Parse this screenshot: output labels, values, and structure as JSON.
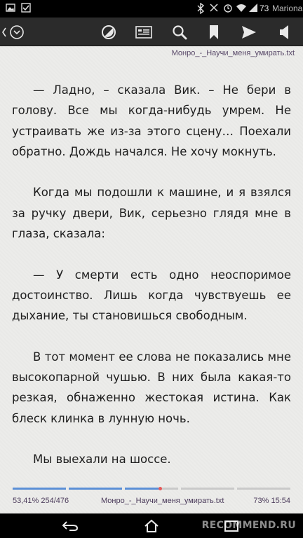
{
  "status_bar": {
    "icons": [
      "image-icon",
      "checkbox-icon",
      "bluetooth-icon",
      "signal-icon",
      "alarm-icon",
      "wifi-icon",
      "cellular-icon",
      "battery-icon"
    ],
    "battery_percent": "73",
    "carrier": "Mariona"
  },
  "toolbar": {
    "buttons": [
      "back-icon",
      "menu-circle-icon",
      "contrast-icon",
      "book-info-icon",
      "search-icon",
      "bookmark-icon",
      "send-icon",
      "volume-icon"
    ]
  },
  "reader": {
    "filename": "Монро_-_Научи_меня_умирать.txt",
    "paragraphs": [
      "— Ладно, – сказала Вик. – Не бери в голову. Все мы когда-нибудь умрем. Не устраивать же из-за этого сцену… Поехали обратно. Дождь начался. Не хочу мокнуть.",
      "Когда мы подошли к машине, и я взялся за ручку двери, Вик, серьезно глядя мне в глаза, сказала:",
      "— У смерти есть одно неоспоримое достоинство. Лишь когда чувствуешь ее дыхание, ты становишься свободным.",
      "В тот момент ее слова не показались мне высокопарной чушью. В них была какая-то резкая, обнаженно жестокая истина. Как блеск клинка в лунную ночь.",
      "Мы выехали на шоссе."
    ]
  },
  "footer": {
    "progress_text": "53,41% 254/476",
    "progress_fraction": 0.5341,
    "filename": "Монро_-_Научи_меня_умирать.txt",
    "battery_time": "73% 15:54"
  },
  "navbar": {
    "buttons": [
      "back-nav-icon",
      "home-nav-icon",
      "recent-apps-icon"
    ],
    "watermark": "RECOMMEND.RU"
  },
  "colors": {
    "toolbar_bg": "#2b2b2b",
    "page_bg": "#ececea",
    "text": "#1e1e1e",
    "progress_fill": "#5b8fd6",
    "progress_marker": "#e65a5a"
  }
}
